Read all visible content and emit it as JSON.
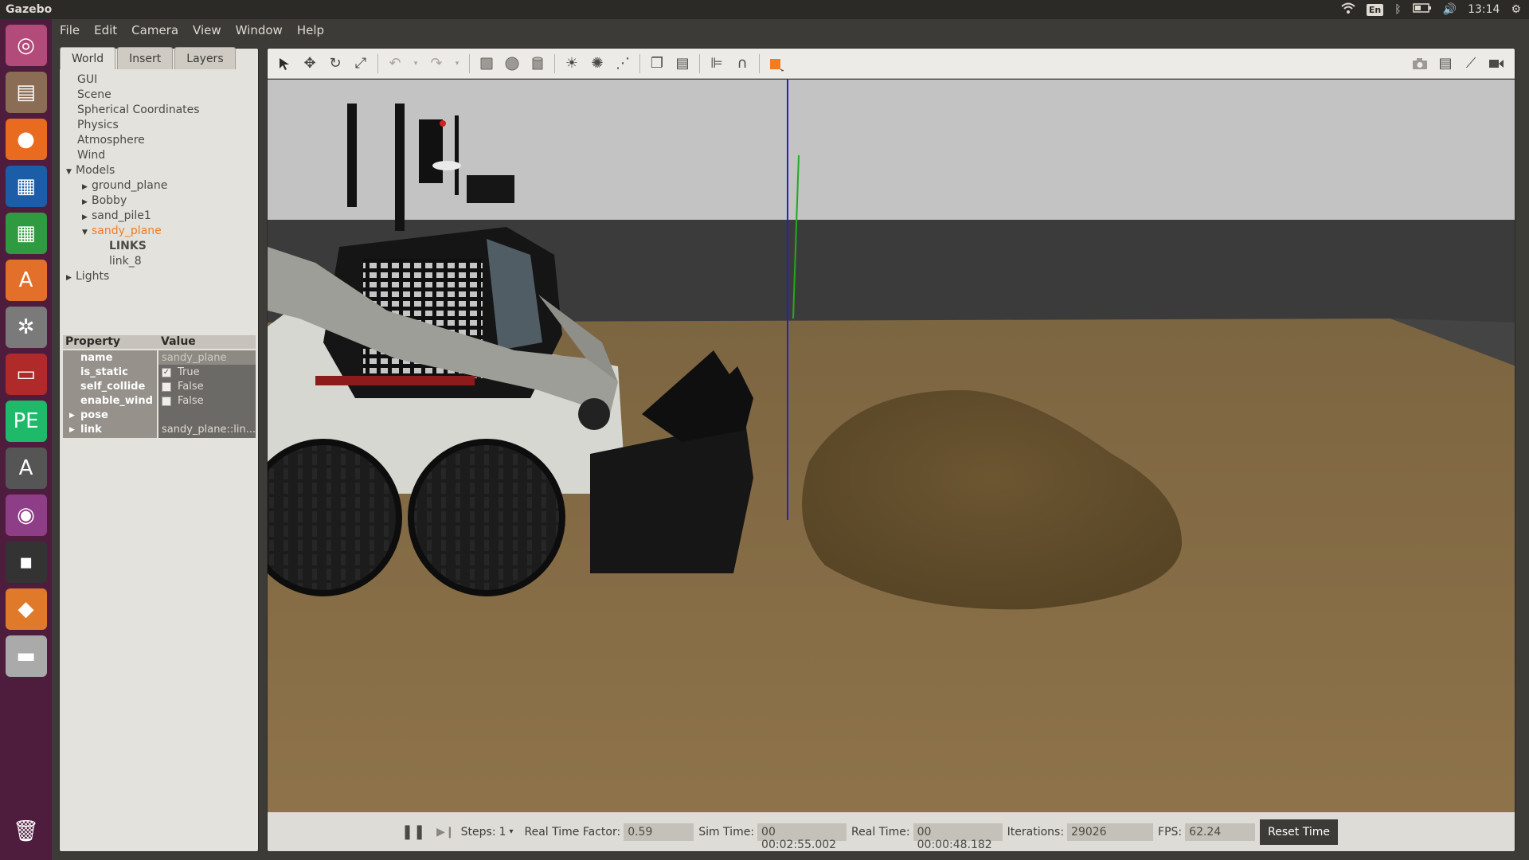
{
  "topbar": {
    "app_title": "Gazebo",
    "keyboard": "En",
    "clock": "13:14"
  },
  "launcher": {
    "items": [
      {
        "name": "ubuntu-dash-icon",
        "glyph": "◎",
        "bg": "#b24b7a"
      },
      {
        "name": "files-icon",
        "glyph": "▤",
        "bg": "#8a6d54"
      },
      {
        "name": "firefox-icon",
        "glyph": "●",
        "bg": "#e86b1f"
      },
      {
        "name": "writer-icon",
        "glyph": "▦",
        "bg": "#1c5da8"
      },
      {
        "name": "calc-icon",
        "glyph": "▦",
        "bg": "#2f9a3f"
      },
      {
        "name": "software-center-icon",
        "glyph": "A",
        "bg": "#e3702a"
      },
      {
        "name": "system-settings-icon",
        "glyph": "✲",
        "bg": "#7a7a7a"
      },
      {
        "name": "terminal-red-icon",
        "glyph": "▭",
        "bg": "#b02a2a"
      },
      {
        "name": "pycharm-icon",
        "glyph": "PE",
        "bg": "#1fb96a"
      },
      {
        "name": "software-updater-icon",
        "glyph": "A",
        "bg": "#555"
      },
      {
        "name": "webcam-icon",
        "glyph": "◉",
        "bg": "#8e3d87"
      },
      {
        "name": "terminal-icon",
        "glyph": "▪",
        "bg": "#333"
      },
      {
        "name": "gazebo-icon",
        "glyph": "◆",
        "bg": "#e07a2a"
      },
      {
        "name": "drive-icon",
        "glyph": "▬",
        "bg": "#aaa"
      },
      {
        "name": "trash-icon",
        "glyph": "🗑",
        "bg": "#4e1d3e"
      }
    ]
  },
  "menubar": {
    "items": [
      "File",
      "Edit",
      "Camera",
      "View",
      "Window",
      "Help"
    ]
  },
  "leftpanel": {
    "tabs": [
      "World",
      "Insert",
      "Layers"
    ],
    "tree": [
      {
        "label": "GUI",
        "indent": 0,
        "tri": ""
      },
      {
        "label": "Scene",
        "indent": 0,
        "tri": ""
      },
      {
        "label": "Spherical Coordinates",
        "indent": 0,
        "tri": ""
      },
      {
        "label": "Physics",
        "indent": 0,
        "tri": ""
      },
      {
        "label": "Atmosphere",
        "indent": 0,
        "tri": ""
      },
      {
        "label": "Wind",
        "indent": 0,
        "tri": ""
      },
      {
        "label": "Models",
        "indent": 0,
        "tri": "▼"
      },
      {
        "label": "ground_plane",
        "indent": 1,
        "tri": "▶"
      },
      {
        "label": "Bobby",
        "indent": 1,
        "tri": "▶"
      },
      {
        "label": "sand_pile1",
        "indent": 1,
        "tri": "▶"
      },
      {
        "label": "sandy_plane",
        "indent": 1,
        "tri": "▼",
        "selected": true
      },
      {
        "label": "LINKS",
        "indent": 2,
        "tri": "",
        "bold": true
      },
      {
        "label": "link_8",
        "indent": 2,
        "tri": ""
      },
      {
        "label": "Lights",
        "indent": 0,
        "tri": "▶"
      }
    ],
    "properties": {
      "header_property": "Property",
      "header_value": "Value",
      "rows": [
        {
          "key": "name",
          "value": "sandy_plane",
          "type": "text",
          "light": true
        },
        {
          "key": "is_static",
          "value": "True",
          "type": "check",
          "checked": true
        },
        {
          "key": "self_collide",
          "value": "False",
          "type": "check",
          "checked": false
        },
        {
          "key": "enable_wind",
          "value": "False",
          "type": "check",
          "checked": false
        },
        {
          "key": "pose",
          "value": "",
          "type": "expand"
        },
        {
          "key": "link",
          "value": "sandy_plane::lin...",
          "type": "expand"
        }
      ]
    }
  },
  "bottombar": {
    "steps_label": "Steps:",
    "steps_value": "1",
    "rtf_label": "Real Time Factor:",
    "rtf_value": "0.59",
    "sim_label": "Sim Time:",
    "sim_value": "00 00:02:55.002",
    "real_label": "Real Time:",
    "real_value": "00 00:00:48.182",
    "iter_label": "Iterations:",
    "iter_value": "29026",
    "fps_label": "FPS:",
    "fps_value": "62.24",
    "reset_label": "Reset Time"
  },
  "colors": {
    "selected": "#f07d24",
    "ground": "#7d6440",
    "sky": "#c8c8c8",
    "wall": "#3a3a3a"
  }
}
